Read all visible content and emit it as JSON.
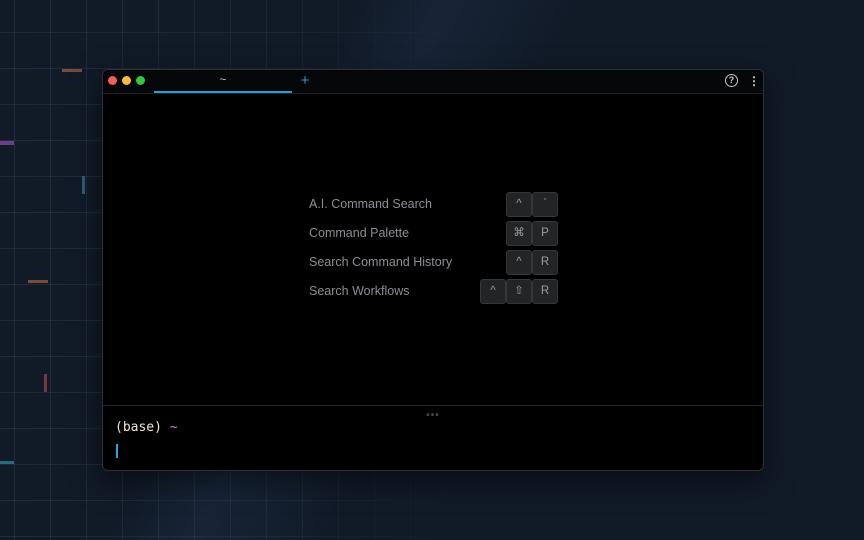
{
  "window": {
    "tab": {
      "title": "~"
    },
    "new_tab_symbol": "+",
    "help_symbol": "?",
    "menu_symbol": "⋮"
  },
  "shortcuts": [
    {
      "label": "A.I. Command Search",
      "keys": [
        "^",
        "`"
      ]
    },
    {
      "label": "Command Palette",
      "keys": [
        "⌘",
        "P"
      ]
    },
    {
      "label": "Search Command History",
      "keys": [
        "^",
        "R"
      ]
    },
    {
      "label": "Search Workflows",
      "keys": [
        "^",
        "⇧",
        "R"
      ]
    }
  ],
  "terminal": {
    "prompt_env": "(base)",
    "prompt_dir": "~",
    "drag_handle": "•••"
  },
  "colors": {
    "accent": "#2a9fd6",
    "prompt_text": "#f2e6c9",
    "prompt_dir": "#d679e6"
  }
}
